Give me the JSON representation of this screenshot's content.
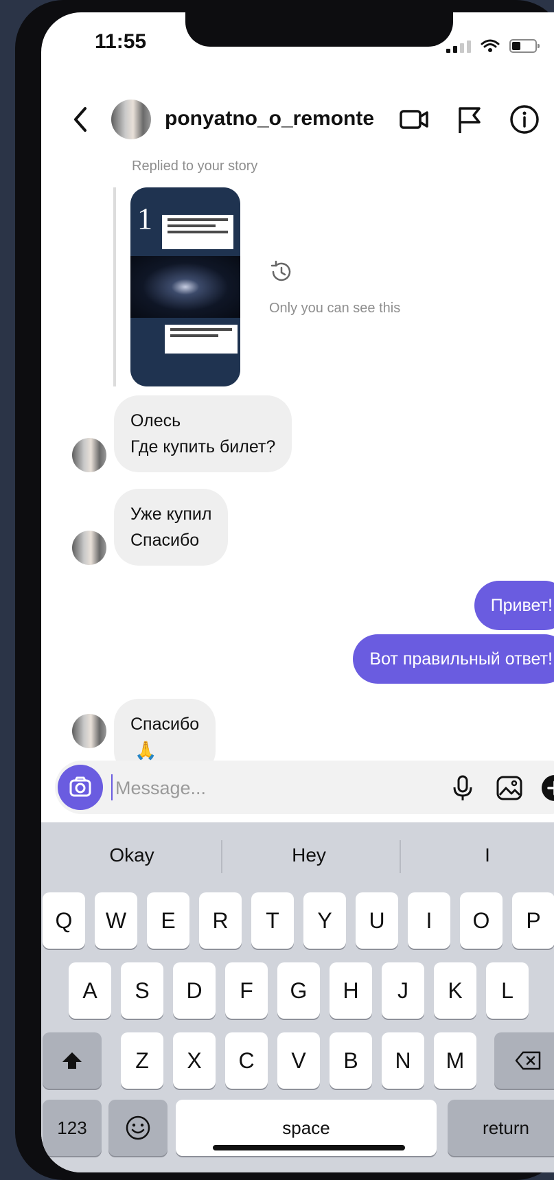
{
  "status": {
    "time": "11:55"
  },
  "header": {
    "username": "ponyatno_o_remonte"
  },
  "story": {
    "replied_label": "Replied to your story",
    "visibility_note": "Only you can see this"
  },
  "messages": [
    {
      "direction": "in",
      "lines": [
        "Олесь",
        "Где купить билет?"
      ]
    },
    {
      "direction": "in",
      "lines": [
        "Уже купил",
        "Спасибо"
      ]
    },
    {
      "direction": "out",
      "lines": [
        "Привет!"
      ]
    },
    {
      "direction": "out",
      "lines": [
        "Вот правильный ответ!"
      ]
    },
    {
      "direction": "in",
      "lines": [
        "Спасибо"
      ],
      "emoji": "🙏"
    }
  ],
  "composer": {
    "placeholder": "Message..."
  },
  "keyboard": {
    "suggestions": [
      "Okay",
      "Hey",
      "I"
    ],
    "row1": [
      "Q",
      "W",
      "E",
      "R",
      "T",
      "Y",
      "U",
      "I",
      "O",
      "P"
    ],
    "row2": [
      "A",
      "S",
      "D",
      "F",
      "G",
      "H",
      "J",
      "K",
      "L"
    ],
    "row3": [
      "Z",
      "X",
      "C",
      "V",
      "B",
      "N",
      "M"
    ],
    "numbers_key": "123",
    "space_key": "space",
    "return_key": "return"
  },
  "colors": {
    "accent": "#6a5ce0",
    "bubble_in": "#efefef",
    "keyboard_bg": "#d1d4db"
  }
}
